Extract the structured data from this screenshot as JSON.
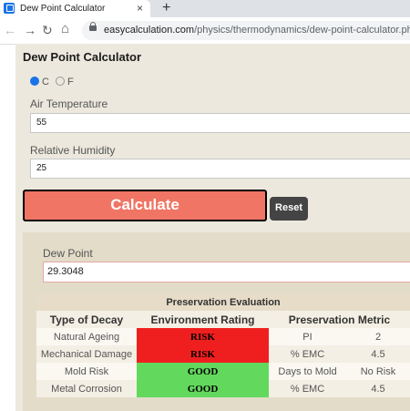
{
  "browser": {
    "tab_title": "Dew Point Calculator",
    "tab_close": "×",
    "new_tab": "+",
    "url_domain": "easycalculation.com",
    "url_path": "/physics/thermodynamics/dew-point-calculator.php",
    "nav_icons": [
      "back-arrow",
      "forward-arrow",
      "reload",
      "home",
      "lock"
    ]
  },
  "calculator": {
    "title": "Dew Point Calculator",
    "unit_c": "C",
    "unit_f": "F",
    "selected_unit": "C",
    "air_temp_label": "Air Temperature",
    "air_temp_value": "55",
    "humidity_label": "Relative Humidity",
    "humidity_value": "25",
    "calculate_label": "Calculate",
    "reset_label": "Reset"
  },
  "result": {
    "dew_point_label": "Dew Point",
    "dew_point_value": "29.3048",
    "table_title": "Preservation Evaluation",
    "headers": [
      "Type of Decay",
      "Environment Rating",
      "Preservation Metric"
    ],
    "rows": [
      {
        "type": "Natural Ageing",
        "rating": "RISK",
        "metric": "PI",
        "value": "2"
      },
      {
        "type": "Mechanical Damage",
        "rating": "RISK",
        "metric": "% EMC",
        "value": "4.5"
      },
      {
        "type": "Mold Risk",
        "rating": "GOOD",
        "metric": "Days to Mold",
        "value": "No Risk"
      },
      {
        "type": "Metal Corrosion",
        "rating": "GOOD",
        "metric": "% EMC",
        "value": "4.5"
      }
    ]
  },
  "colors": {
    "calculate_bg": "#f07565",
    "risk": "#f01f1f",
    "good": "#62d95d",
    "panel_bg": "#ece8dd"
  }
}
